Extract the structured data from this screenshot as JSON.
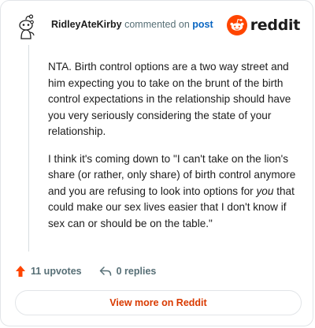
{
  "comment": {
    "author": "RidleyAteKirby",
    "action_text": "commented on",
    "post_link_text": "post",
    "paragraphs": [
      "NTA. Birth control options are a two way street and him expecting you to take on the brunt of the birth control expectations in the relationship should have you very seriously considering the state of your relationship."
    ],
    "quote_paragraph": {
      "before": "I think it's coming down to \"I can't take on the lion's share (or rather, only share) of birth control anymore and you are refusing to look into options for ",
      "emphasis": "you",
      "after": " that could make our sex lives easier that I don't know if sex can or should be on the table.\""
    }
  },
  "brand": {
    "wordmark": "reddit",
    "icon": "reddit-snoo-icon",
    "color": "#ff4500"
  },
  "footer": {
    "upvotes_label": "11 upvotes",
    "replies_label": "0 replies",
    "upvote_icon": "upvote-arrow-icon",
    "reply_icon": "reply-arrow-icon",
    "upvote_color": "#ff4500"
  },
  "cta": {
    "label": "View more on Reddit",
    "color": "#d93a00"
  },
  "avatar": {
    "icon": "snoo-avatar-icon"
  }
}
